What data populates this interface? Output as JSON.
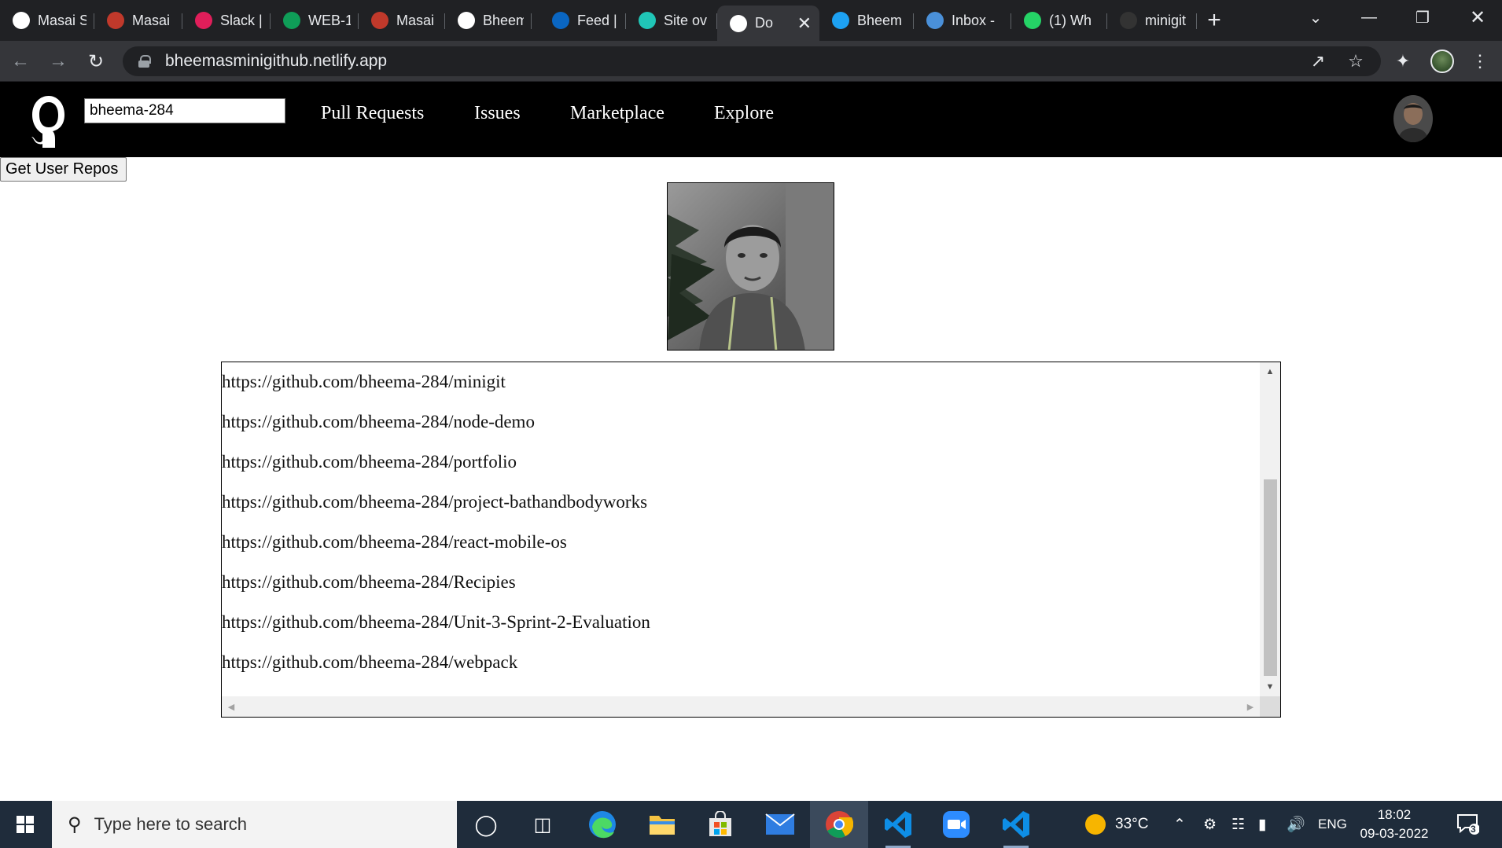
{
  "browser": {
    "tabs": [
      {
        "title": "Masai S",
        "icon": "globe-icon",
        "color": "#ffffff"
      },
      {
        "title": "Masai |",
        "icon": "masai-icon",
        "color": "#c0392b"
      },
      {
        "title": "Slack |",
        "icon": "slack-icon",
        "color": "#e01e5a"
      },
      {
        "title": "WEB-1",
        "icon": "sheets-icon",
        "color": "#0f9d58"
      },
      {
        "title": "Masai |",
        "icon": "masai-icon",
        "color": "#c0392b"
      },
      {
        "title": "Bheem",
        "icon": "wordpress-icon",
        "color": "#ffffff"
      },
      {
        "title": "Feed |",
        "icon": "linkedin-icon",
        "color": "#0a66c2"
      },
      {
        "title": "Site ov",
        "icon": "netlify-icon",
        "color": "#20c6b7"
      },
      {
        "title": "Do",
        "icon": "globe-icon",
        "color": "#ffffff",
        "active": true
      },
      {
        "title": "Bheem",
        "icon": "twitter-icon",
        "color": "#1da1f2"
      },
      {
        "title": "Inbox -",
        "icon": "inbox-icon",
        "color": "#4a90d9"
      },
      {
        "title": "(1) Wh",
        "icon": "whatsapp-icon",
        "color": "#25d366"
      },
      {
        "title": "minigit",
        "icon": "github-icon",
        "color": "#333333"
      }
    ],
    "new_tab_label": "+",
    "url": "bheemasminigithub.netlify.app"
  },
  "page": {
    "search_value": "bheema-284",
    "nav": [
      "Pull Requests",
      "Issues",
      "Marketplace",
      "Explore"
    ],
    "get_repos_label": "Get User Repos",
    "repos": [
      "https://github.com/bheema-284/minigit",
      "https://github.com/bheema-284/node-demo",
      "https://github.com/bheema-284/portfolio",
      "https://github.com/bheema-284/project-bathandbodyworks",
      "https://github.com/bheema-284/react-mobile-os",
      "https://github.com/bheema-284/Recipies",
      "https://github.com/bheema-284/Unit-3-Sprint-2-Evaluation",
      "https://github.com/bheema-284/webpack"
    ]
  },
  "taskbar": {
    "search_placeholder": "Type here to search",
    "temperature": "33°C",
    "language": "ENG",
    "time": "18:02",
    "date": "09-03-2022",
    "notification_count": "3"
  }
}
